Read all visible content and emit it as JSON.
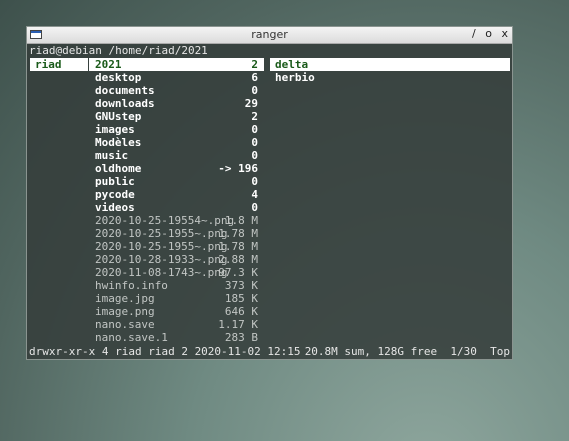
{
  "window": {
    "title": "ranger",
    "controls": [
      "/",
      "o",
      "x"
    ]
  },
  "path": "riad@debian /home/riad/2021",
  "parent_column": {
    "selected": "riad"
  },
  "main_column": {
    "entries": [
      {
        "name": "2021",
        "size": "2",
        "type": "dir",
        "selected": true
      },
      {
        "name": "desktop",
        "size": "6",
        "type": "dir"
      },
      {
        "name": "documents",
        "size": "0",
        "type": "dir"
      },
      {
        "name": "downloads",
        "size": "29",
        "type": "dir"
      },
      {
        "name": "GNUstep",
        "size": "2",
        "type": "dir"
      },
      {
        "name": "images",
        "size": "0",
        "type": "dir"
      },
      {
        "name": "Modèles",
        "size": "0",
        "type": "dir"
      },
      {
        "name": "music",
        "size": "0",
        "type": "dir"
      },
      {
        "name": "oldhome",
        "size": "-> 196",
        "type": "dir"
      },
      {
        "name": "public",
        "size": "0",
        "type": "dir"
      },
      {
        "name": "pycode",
        "size": "4",
        "type": "dir"
      },
      {
        "name": "videos",
        "size": "0",
        "type": "dir"
      },
      {
        "name": "2020-10-25-19554~.png",
        "size": "1.8 M",
        "type": "file"
      },
      {
        "name": "2020-10-25-1955~.png",
        "size": "1.78 M",
        "type": "file"
      },
      {
        "name": "2020-10-25-1955~.png",
        "size": "1.78 M",
        "type": "file"
      },
      {
        "name": "2020-10-28-1933~.png",
        "size": "2.88 M",
        "type": "file"
      },
      {
        "name": "2020-11-08-1743~.png",
        "size": "97.3 K",
        "type": "file"
      },
      {
        "name": "hwinfo.info",
        "size": "373 K",
        "type": "file"
      },
      {
        "name": "image.jpg",
        "size": "185 K",
        "type": "file"
      },
      {
        "name": "image.png",
        "size": "646 K",
        "type": "file"
      },
      {
        "name": "nano.save",
        "size": "1.17 K",
        "type": "file"
      },
      {
        "name": "nano.save.1",
        "size": "283 B",
        "type": "file"
      }
    ]
  },
  "preview_column": {
    "entries": [
      {
        "name": "delta",
        "selected": true
      },
      {
        "name": "herbio",
        "selected": false
      }
    ]
  },
  "status": {
    "left": "drwxr-xr-x 4 riad riad 2 2020-11-02 12:15",
    "right": "20.8M sum, 128G free  1/30  Top"
  }
}
